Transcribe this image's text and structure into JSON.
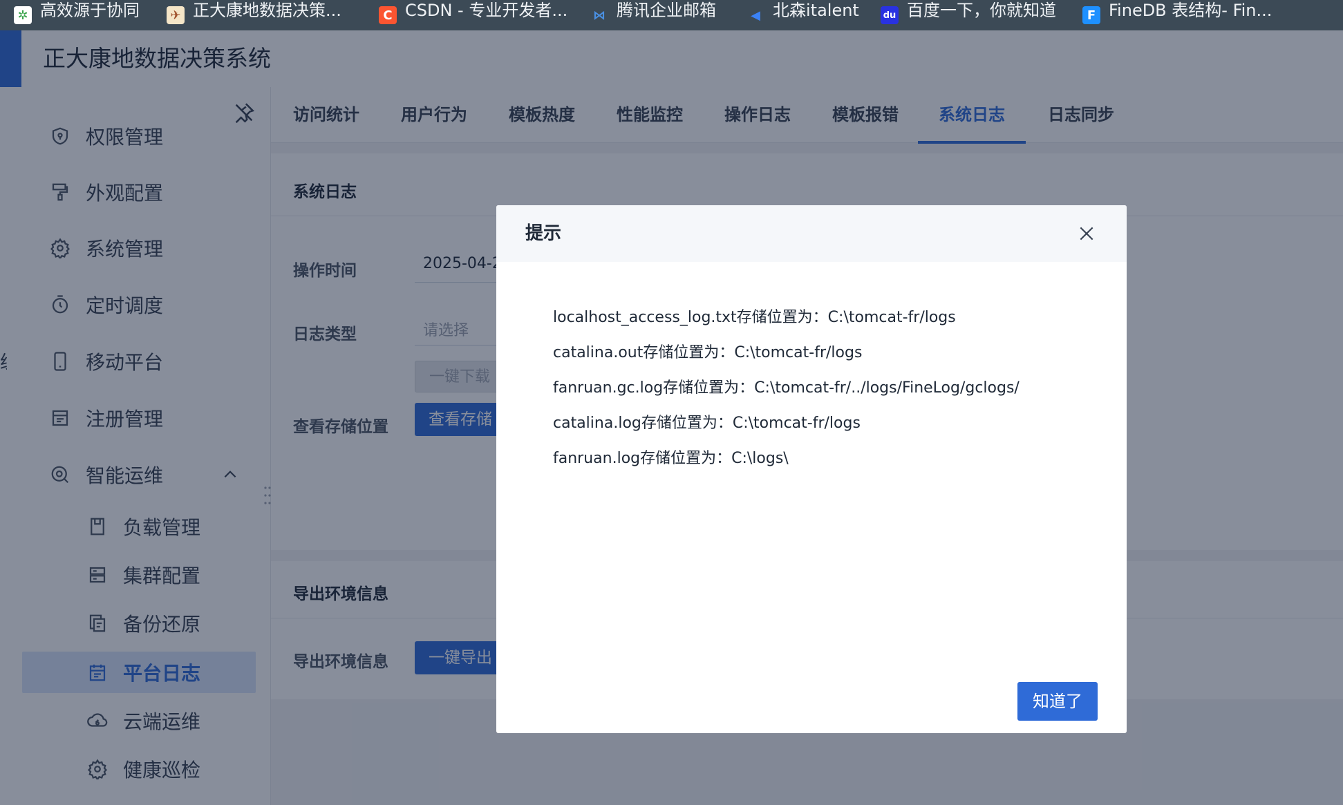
{
  "bookmarks": [
    {
      "label": "高效源于协同",
      "icon": "xietong-icon",
      "icon_char": "✲",
      "icon_bg": "#ffffff",
      "icon_color": "#3aa34b"
    },
    {
      "label": "正大康地数据决策...",
      "icon": "finereport-logo-icon",
      "icon_char": "✈",
      "icon_bg": "#f5e6c8",
      "icon_color": "#a0522d"
    },
    {
      "label": "CSDN - 专业开发者...",
      "icon": "csdn-icon",
      "icon_char": "C",
      "icon_bg": "#fc5531",
      "icon_color": "#ffffff"
    },
    {
      "label": "腾讯企业邮箱",
      "icon": "tencent-mail-icon",
      "icon_char": "⋈",
      "icon_bg": "transparent",
      "icon_color": "#4a90e2"
    },
    {
      "label": "北森italent",
      "icon": "beisen-icon",
      "icon_char": "◀",
      "icon_bg": "transparent",
      "icon_color": "#3b82f6"
    },
    {
      "label": "百度一下，你就知道",
      "icon": "baidu-icon",
      "icon_char": "du",
      "icon_bg": "#2932e1",
      "icon_color": "#ffffff"
    },
    {
      "label": "FineDB 表结构- Fin...",
      "icon": "finedb-icon",
      "icon_char": "F",
      "icon_bg": "#1e90ff",
      "icon_color": "#ffffff"
    }
  ],
  "app": {
    "title": "正大康地数据决策系统"
  },
  "sidebar": {
    "cut_text": "统",
    "items": [
      {
        "label": "权限管理",
        "icon": "shield-icon"
      },
      {
        "label": "外观配置",
        "icon": "paint-roller-icon"
      },
      {
        "label": "系统管理",
        "icon": "gear-icon"
      },
      {
        "label": "定时调度",
        "icon": "timer-icon"
      },
      {
        "label": "移动平台",
        "icon": "mobile-icon"
      },
      {
        "label": "注册管理",
        "icon": "register-icon"
      },
      {
        "label": "智能运维",
        "icon": "smart-ops-icon"
      }
    ],
    "sub_items": [
      {
        "label": "负载管理",
        "icon": "load-icon"
      },
      {
        "label": "集群配置",
        "icon": "cluster-icon"
      },
      {
        "label": "备份还原",
        "icon": "backup-icon"
      },
      {
        "label": "平台日志",
        "icon": "calendar-log-icon"
      },
      {
        "label": "云端运维",
        "icon": "cloud-ops-icon"
      },
      {
        "label": "健康巡检",
        "icon": "health-check-icon"
      }
    ]
  },
  "tabs": [
    "访问统计",
    "用户行为",
    "模板热度",
    "性能监控",
    "操作日志",
    "模板报错",
    "系统日志",
    "日志同步"
  ],
  "active_tab": "系统日志",
  "log_section": {
    "title": "系统日志",
    "op_time_label": "操作时间",
    "op_time_value": "2025-04-2",
    "log_type_label": "日志类型",
    "log_type_placeholder": "请选择",
    "download_button": "一键下载",
    "storage_label": "查看存储位置",
    "storage_button": "查看存储"
  },
  "env_section": {
    "title": "导出环境信息",
    "label": "导出环境信息",
    "button": "一键导出"
  },
  "dialog": {
    "title": "提示",
    "lines": [
      "localhost_access_log.txt存储位置为：C:\\tomcat-fr/logs",
      "catalina.out存储位置为：C:\\tomcat-fr/logs",
      "fanruan.gc.log存储位置为：C:\\tomcat-fr/../logs/FineLog/gclogs/",
      "catalina.log存储位置为：C:\\tomcat-fr/logs",
      "fanruan.log存储位置为：C:\\logs\\"
    ],
    "ok_button": "知道了"
  },
  "colors": {
    "accent": "#2f6bd7",
    "overlay": "rgba(17,30,56,0.5)"
  }
}
